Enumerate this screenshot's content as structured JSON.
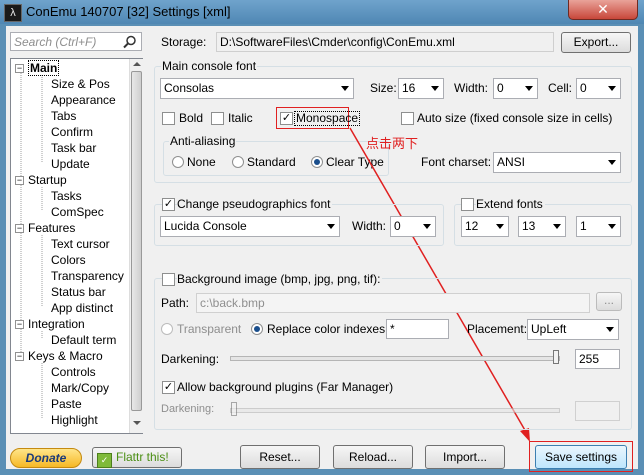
{
  "window": {
    "app_icon_glyph": "λ",
    "title": "ConEmu 140707 [32] Settings [xml]",
    "close_glyph": "✕"
  },
  "search": {
    "placeholder": "Search (Ctrl+F)"
  },
  "tree": {
    "items": [
      "Main",
      "Size & Pos",
      "Appearance",
      "Tabs",
      "Confirm",
      "Task bar",
      "Update",
      "Startup",
      "Tasks",
      "ComSpec",
      "Features",
      "Text cursor",
      "Colors",
      "Transparency",
      "Status bar",
      "App distinct",
      "Integration",
      "Default term",
      "Keys & Macro",
      "Controls",
      "Mark/Copy",
      "Paste",
      "Highlight"
    ],
    "selected": "Main"
  },
  "storage": {
    "label": "Storage:",
    "path": "D:\\SoftwareFiles\\Cmder\\config\\ConEmu.xml",
    "export_label": "Export..."
  },
  "main_font": {
    "group_label": "Main console font",
    "font": "Consolas",
    "size_label": "Size:",
    "size": "16",
    "width_label": "Width:",
    "width": "0",
    "cell_label": "Cell:",
    "cell": "0",
    "bold_label": "Bold",
    "italic_label": "Italic",
    "monospace_label": "Monospace",
    "autosize_label": "Auto size (fixed console size in cells)",
    "aa_label": "Anti-aliasing",
    "aa_none": "None",
    "aa_standard": "Standard",
    "aa_cleartype": "Clear Type",
    "charset_label": "Font charset:",
    "charset": "ANSI"
  },
  "annotation": {
    "text": "点击两下"
  },
  "pseudo": {
    "label": "Change pseudographics font",
    "font": "Lucida Console",
    "width_label": "Width:",
    "width": "0"
  },
  "extend": {
    "label": "Extend fonts",
    "v1": "12",
    "v2": "13",
    "v3": "1"
  },
  "background": {
    "label": "Background image (bmp, jpg, png, tif):",
    "path_label": "Path:",
    "path": "c:\\back.bmp",
    "browse": "...",
    "transparent": "Transparent",
    "replace": "Replace color indexes",
    "replace_value": "*",
    "placement_label": "Placement:",
    "placement": "UpLeft",
    "darkening_label": "Darkening:",
    "darkening": "255",
    "plugins_label": "Allow background plugins (Far Manager)",
    "darkening2_label": "Darkening:"
  },
  "footer": {
    "donate": "Donate",
    "flattr": "Flattr this!",
    "reset": "Reset...",
    "reload": "Reload...",
    "import": "Import...",
    "save": "Save settings"
  },
  "colors": {
    "accent": "#e02020",
    "selection": "#3399ff"
  }
}
